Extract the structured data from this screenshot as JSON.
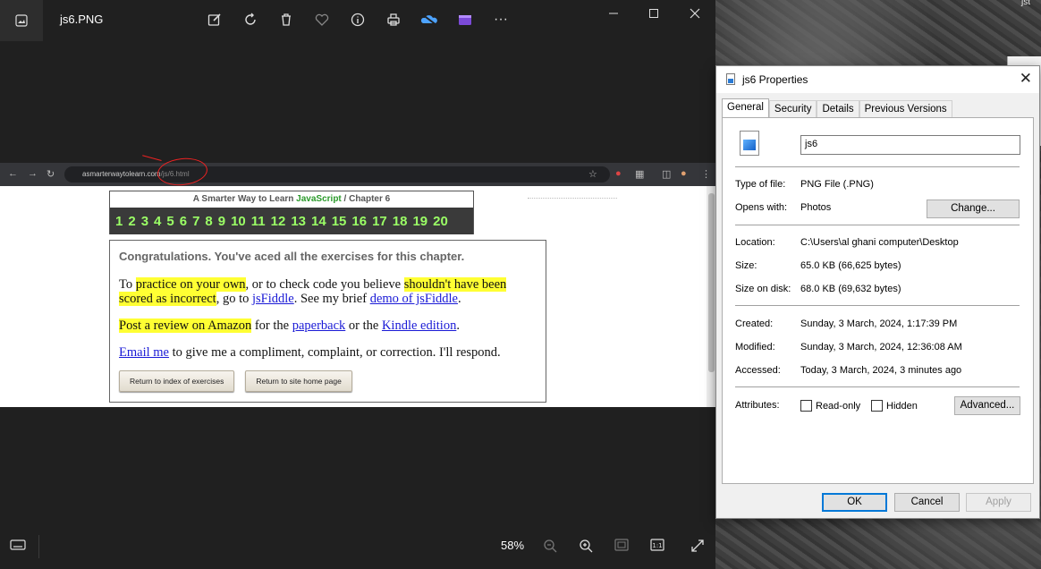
{
  "desktop": {
    "corner_text": "jst"
  },
  "photos": {
    "file_name": "js6.PNG",
    "toolbar_icons": [
      "edit-icon",
      "rotate-icon",
      "delete-icon",
      "heart-icon",
      "info-icon",
      "print-icon",
      "onedrive-icon",
      "clipchamp-icon",
      "more-icon"
    ],
    "more_label": "···",
    "zoom_level": "58%"
  },
  "screenshot": {
    "url_host": "asmarterwaytolearn.com",
    "url_path": "/js/6.html",
    "chapter_title_prefix": "A Smarter Way to Learn",
    "chapter_title_js": "JavaScript",
    "chapter_title_suffix": "/  Chapter 6",
    "chapter_numbers": [
      "1",
      "2",
      "3",
      "4",
      "5",
      "6",
      "7",
      "8",
      "9",
      "10",
      "11",
      "12",
      "13",
      "14",
      "15",
      "16",
      "17",
      "18",
      "19",
      "20"
    ],
    "congrats": "Congratulations. You've aced all the exercises for this chapter.",
    "p1_a": "To ",
    "p1_hl1": "practice on your own",
    "p1_b": ", or to check code you believe ",
    "p1_hl2": "shouldn't have been scored as incorrect",
    "p1_c": ", go to ",
    "p1_link1": "jsFiddle",
    "p1_d": ". See my brief ",
    "p1_link2": "demo of jsFiddle",
    "p1_e": ".",
    "p2_hl": "Post a review on Amazon",
    "p2_a": " for the ",
    "p2_link1": "paperback",
    "p2_b": " or the ",
    "p2_link2": "Kindle edition",
    "p2_c": ".",
    "p3_link": "Email me",
    "p3_a": " to give me a compliment, complaint, or correction. I'll respond.",
    "btn_index": "Return to index of exercises",
    "btn_home": "Return to site home page"
  },
  "dialog": {
    "title": "js6 Properties",
    "tabs": [
      "General",
      "Security",
      "Details",
      "Previous Versions"
    ],
    "file_name": "js6",
    "type_label": "Type of file:",
    "type_value": "PNG File (.PNG)",
    "opens_label": "Opens with:",
    "opens_value": "Photos",
    "change_btn": "Change...",
    "location_label": "Location:",
    "location_value": "C:\\Users\\al ghani computer\\Desktop",
    "size_label": "Size:",
    "size_value": "65.0 KB (66,625 bytes)",
    "disk_label": "Size on disk:",
    "disk_value": "68.0 KB (69,632 bytes)",
    "created_label": "Created:",
    "created_value": "Sunday, 3 March, 2024, 1:17:39 PM",
    "modified_label": "Modified:",
    "modified_value": "Sunday, 3 March, 2024, 12:36:08 AM",
    "accessed_label": "Accessed:",
    "accessed_value": "Today, 3 March, 2024, 3 minutes ago",
    "attributes_label": "Attributes:",
    "readonly_label": "Read-only",
    "hidden_label": "Hidden",
    "advanced_btn": "Advanced...",
    "ok_btn": "OK",
    "cancel_btn": "Cancel",
    "apply_btn": "Apply"
  }
}
